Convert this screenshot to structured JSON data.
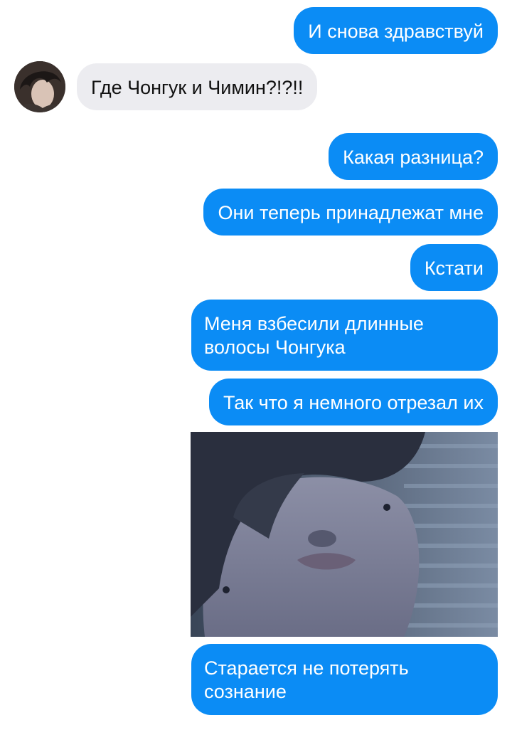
{
  "conversation": {
    "messages": [
      {
        "direction": "outgoing",
        "text": "И снова здравствуй"
      },
      {
        "direction": "incoming",
        "text": "Где Чонгук и Чимин?!?!!"
      },
      {
        "direction": "outgoing",
        "text": "Какая разница?"
      },
      {
        "direction": "outgoing",
        "text": "Они теперь принадлежат мне"
      },
      {
        "direction": "outgoing",
        "text": "Кстати"
      },
      {
        "direction": "outgoing",
        "text": "Меня взбесили длинные волосы Чонгука"
      },
      {
        "direction": "outgoing",
        "text": "Так что я немного отрезал их"
      },
      {
        "direction": "outgoing",
        "text": "Старается не потерять сознание"
      }
    ]
  },
  "colors": {
    "outgoing_bubble": "#0b8cf5",
    "incoming_bubble": "#ececf0",
    "outgoing_text": "#ffffff",
    "incoming_text": "#111111"
  },
  "icons": {
    "avatar": "contact-avatar-photo",
    "photo": "shared-photo"
  }
}
